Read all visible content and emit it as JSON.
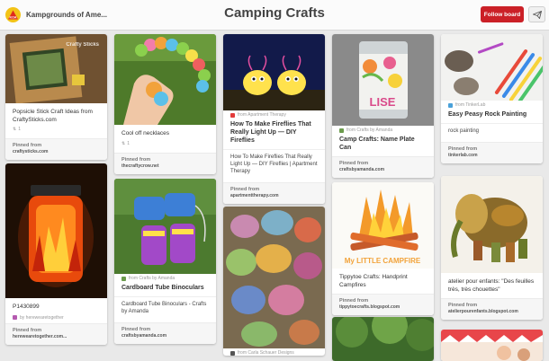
{
  "header": {
    "owner": "Kampgrounds of Ame...",
    "title": "Camping Crafts",
    "follow_label": "Follow board"
  },
  "pins": [
    {
      "desc": "Popsicle Stick Craft Ideas from CraftySticks.com",
      "repins": "1",
      "pinned_from_label": "Pinned from",
      "pinned_from": "craftysticks.com"
    },
    {
      "desc": "P1430899",
      "source": "by herewearetogether",
      "pinned_from_label": "Pinned from",
      "pinned_from": "herewearetogether.com..."
    },
    {
      "desc": "Cool off necklaces",
      "repins": "1",
      "pinned_from_label": "Pinned from",
      "pinned_from": "thecraftycrow.net"
    },
    {
      "source": "from Crafts by Amanda",
      "title": "Cardboard Tube Binoculars",
      "body": "Cardboard Tube Binoculars - Crafts by Amanda",
      "pinned_from_label": "Pinned from",
      "pinned_from": "craftsbyamanda.com"
    },
    {
      "source": "from Apartment Therapy",
      "title": "How To Make Fireflies That Really Light Up — DIY Fireflies",
      "body": "How To Make Fireflies That Really Light Up — DIY Fireflies | Apartment Therapy",
      "pinned_from_label": "Pinned from",
      "pinned_from": "apartmenttherapy.com"
    },
    {
      "source": "from Carla Schauer Designs"
    },
    {
      "source": "from Crafts by Amanda",
      "title": "Camp Crafts: Name Plate Can",
      "pinned_from_label": "Pinned from",
      "pinned_from": "craftsbyamanda.com"
    },
    {
      "desc": "Tippytoe Crafts: Handprint Campfires",
      "pinned_from_label": "Pinned from",
      "pinned_from": "tippytoecrafts.blogspot.com"
    },
    {
      "source": "from TinkerLab",
      "title": "Easy Peasy Rock Painting",
      "body": "rock painting",
      "pinned_from_label": "Pinned from",
      "pinned_from": "tinkerlab.com"
    },
    {
      "desc": "atelier pour enfants: \"Des feuilles très, très chouettes\"",
      "pinned_from_label": "Pinned from",
      "pinned_from": "atelierpourenfants.blogspot.com"
    }
  ],
  "image_texts": {
    "can_name": "LISE",
    "campfire_caption": "My LITTLE CAMPFIRE",
    "frame_watermark": "Crafty Sticks"
  },
  "colors": {
    "accent": "#cb2027",
    "avatar": "#f3c316"
  }
}
